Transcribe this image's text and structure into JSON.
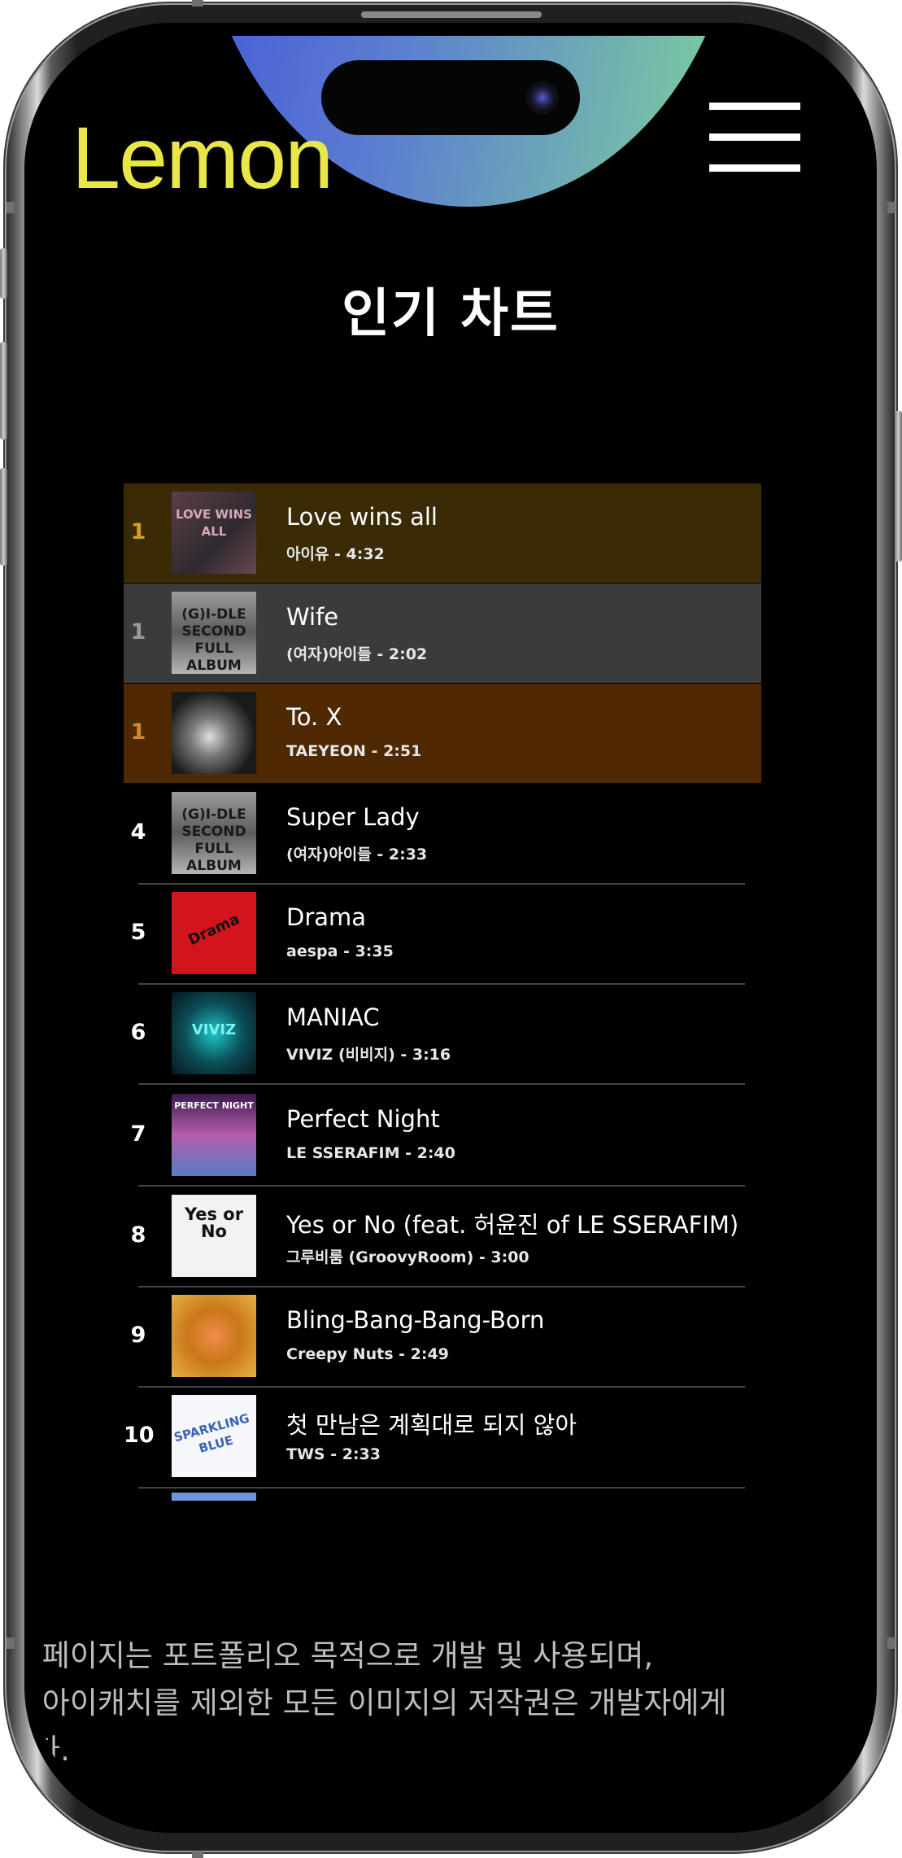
{
  "brand": {
    "logo_text": "Lemon",
    "accent": "#e9e647"
  },
  "header": {
    "menu_icon": "hamburger-menu-icon"
  },
  "page": {
    "title": "인기 차트"
  },
  "chart": {
    "rows": [
      {
        "rank": "1",
        "title": "Love wins all",
        "meta": "아이유 - 4:32",
        "cover_text": "LOVE WINS ALL"
      },
      {
        "rank": "1",
        "title": "Wife",
        "meta": "(여자)아이들 - 2:02",
        "cover_text": "(G)I-DLE SECOND FULL ALBUM"
      },
      {
        "rank": "1",
        "title": "To. X",
        "meta": "TAEYEON - 2:51",
        "cover_text": ""
      },
      {
        "rank": "4",
        "title": "Super Lady",
        "meta": "(여자)아이들 - 2:33",
        "cover_text": "(G)I-DLE SECOND FULL ALBUM"
      },
      {
        "rank": "5",
        "title": "Drama",
        "meta": "aespa - 3:35",
        "cover_text": "Drama"
      },
      {
        "rank": "6",
        "title": "MANIAC",
        "meta": "VIVIZ (비비지) - 3:16",
        "cover_text": "VIVIZ"
      },
      {
        "rank": "7",
        "title": "Perfect Night",
        "meta": "LE SSERAFIM - 2:40",
        "cover_text": "PERFECT NIGHT"
      },
      {
        "rank": "8",
        "title": "Yes or No (feat. 허윤진 of LE SSERAFIM)",
        "meta": "그루비룸 (GroovyRoom) - 3:00",
        "cover_text": "Yes or No"
      },
      {
        "rank": "9",
        "title": "Bling-Bang-Bang-Born",
        "meta": "Creepy Nuts - 2:49",
        "cover_text": ""
      },
      {
        "rank": "10",
        "title": "첫 만남은 계획대로 되지 않아",
        "meta": "TWS - 2:33",
        "cover_text": "SPARKLING BLUE"
      }
    ]
  },
  "footer": {
    "line1": "본 페이지는 포트폴리오 목적으로 개발 및 사용되며,",
    "line2": "범 아이캐치를 제외한 모든 이미지의 저작권은 개발자에게",
    "line3": "니다."
  }
}
